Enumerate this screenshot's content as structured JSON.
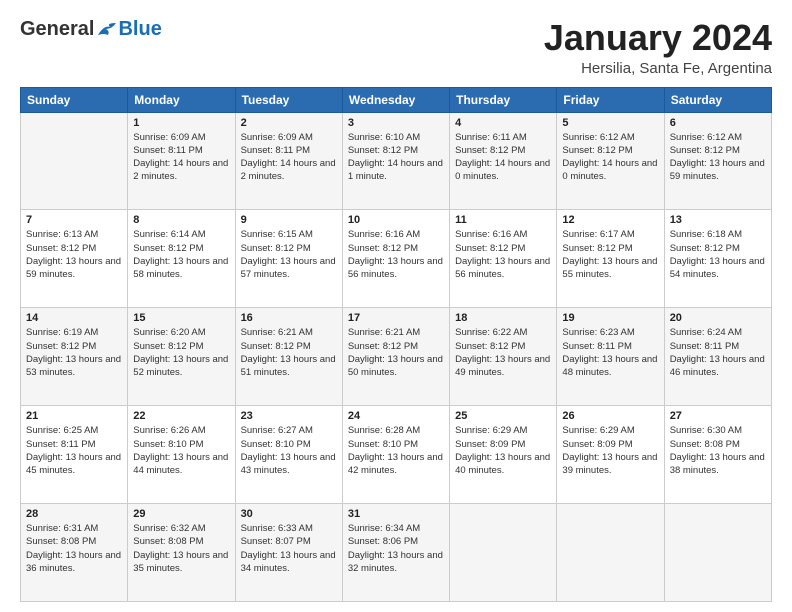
{
  "logo": {
    "general": "General",
    "blue": "Blue"
  },
  "header": {
    "month": "January 2024",
    "location": "Hersilia, Santa Fe, Argentina"
  },
  "weekdays": [
    "Sunday",
    "Monday",
    "Tuesday",
    "Wednesday",
    "Thursday",
    "Friday",
    "Saturday"
  ],
  "weeks": [
    [
      {
        "day": "",
        "sunrise": "",
        "sunset": "",
        "daylight": ""
      },
      {
        "day": "1",
        "sunrise": "Sunrise: 6:09 AM",
        "sunset": "Sunset: 8:11 PM",
        "daylight": "Daylight: 14 hours and 2 minutes."
      },
      {
        "day": "2",
        "sunrise": "Sunrise: 6:09 AM",
        "sunset": "Sunset: 8:11 PM",
        "daylight": "Daylight: 14 hours and 2 minutes."
      },
      {
        "day": "3",
        "sunrise": "Sunrise: 6:10 AM",
        "sunset": "Sunset: 8:12 PM",
        "daylight": "Daylight: 14 hours and 1 minute."
      },
      {
        "day": "4",
        "sunrise": "Sunrise: 6:11 AM",
        "sunset": "Sunset: 8:12 PM",
        "daylight": "Daylight: 14 hours and 0 minutes."
      },
      {
        "day": "5",
        "sunrise": "Sunrise: 6:12 AM",
        "sunset": "Sunset: 8:12 PM",
        "daylight": "Daylight: 14 hours and 0 minutes."
      },
      {
        "day": "6",
        "sunrise": "Sunrise: 6:12 AM",
        "sunset": "Sunset: 8:12 PM",
        "daylight": "Daylight: 13 hours and 59 minutes."
      }
    ],
    [
      {
        "day": "7",
        "sunrise": "Sunrise: 6:13 AM",
        "sunset": "Sunset: 8:12 PM",
        "daylight": "Daylight: 13 hours and 59 minutes."
      },
      {
        "day": "8",
        "sunrise": "Sunrise: 6:14 AM",
        "sunset": "Sunset: 8:12 PM",
        "daylight": "Daylight: 13 hours and 58 minutes."
      },
      {
        "day": "9",
        "sunrise": "Sunrise: 6:15 AM",
        "sunset": "Sunset: 8:12 PM",
        "daylight": "Daylight: 13 hours and 57 minutes."
      },
      {
        "day": "10",
        "sunrise": "Sunrise: 6:16 AM",
        "sunset": "Sunset: 8:12 PM",
        "daylight": "Daylight: 13 hours and 56 minutes."
      },
      {
        "day": "11",
        "sunrise": "Sunrise: 6:16 AM",
        "sunset": "Sunset: 8:12 PM",
        "daylight": "Daylight: 13 hours and 56 minutes."
      },
      {
        "day": "12",
        "sunrise": "Sunrise: 6:17 AM",
        "sunset": "Sunset: 8:12 PM",
        "daylight": "Daylight: 13 hours and 55 minutes."
      },
      {
        "day": "13",
        "sunrise": "Sunrise: 6:18 AM",
        "sunset": "Sunset: 8:12 PM",
        "daylight": "Daylight: 13 hours and 54 minutes."
      }
    ],
    [
      {
        "day": "14",
        "sunrise": "Sunrise: 6:19 AM",
        "sunset": "Sunset: 8:12 PM",
        "daylight": "Daylight: 13 hours and 53 minutes."
      },
      {
        "day": "15",
        "sunrise": "Sunrise: 6:20 AM",
        "sunset": "Sunset: 8:12 PM",
        "daylight": "Daylight: 13 hours and 52 minutes."
      },
      {
        "day": "16",
        "sunrise": "Sunrise: 6:21 AM",
        "sunset": "Sunset: 8:12 PM",
        "daylight": "Daylight: 13 hours and 51 minutes."
      },
      {
        "day": "17",
        "sunrise": "Sunrise: 6:21 AM",
        "sunset": "Sunset: 8:12 PM",
        "daylight": "Daylight: 13 hours and 50 minutes."
      },
      {
        "day": "18",
        "sunrise": "Sunrise: 6:22 AM",
        "sunset": "Sunset: 8:12 PM",
        "daylight": "Daylight: 13 hours and 49 minutes."
      },
      {
        "day": "19",
        "sunrise": "Sunrise: 6:23 AM",
        "sunset": "Sunset: 8:11 PM",
        "daylight": "Daylight: 13 hours and 48 minutes."
      },
      {
        "day": "20",
        "sunrise": "Sunrise: 6:24 AM",
        "sunset": "Sunset: 8:11 PM",
        "daylight": "Daylight: 13 hours and 46 minutes."
      }
    ],
    [
      {
        "day": "21",
        "sunrise": "Sunrise: 6:25 AM",
        "sunset": "Sunset: 8:11 PM",
        "daylight": "Daylight: 13 hours and 45 minutes."
      },
      {
        "day": "22",
        "sunrise": "Sunrise: 6:26 AM",
        "sunset": "Sunset: 8:10 PM",
        "daylight": "Daylight: 13 hours and 44 minutes."
      },
      {
        "day": "23",
        "sunrise": "Sunrise: 6:27 AM",
        "sunset": "Sunset: 8:10 PM",
        "daylight": "Daylight: 13 hours and 43 minutes."
      },
      {
        "day": "24",
        "sunrise": "Sunrise: 6:28 AM",
        "sunset": "Sunset: 8:10 PM",
        "daylight": "Daylight: 13 hours and 42 minutes."
      },
      {
        "day": "25",
        "sunrise": "Sunrise: 6:29 AM",
        "sunset": "Sunset: 8:09 PM",
        "daylight": "Daylight: 13 hours and 40 minutes."
      },
      {
        "day": "26",
        "sunrise": "Sunrise: 6:29 AM",
        "sunset": "Sunset: 8:09 PM",
        "daylight": "Daylight: 13 hours and 39 minutes."
      },
      {
        "day": "27",
        "sunrise": "Sunrise: 6:30 AM",
        "sunset": "Sunset: 8:08 PM",
        "daylight": "Daylight: 13 hours and 38 minutes."
      }
    ],
    [
      {
        "day": "28",
        "sunrise": "Sunrise: 6:31 AM",
        "sunset": "Sunset: 8:08 PM",
        "daylight": "Daylight: 13 hours and 36 minutes."
      },
      {
        "day": "29",
        "sunrise": "Sunrise: 6:32 AM",
        "sunset": "Sunset: 8:08 PM",
        "daylight": "Daylight: 13 hours and 35 minutes."
      },
      {
        "day": "30",
        "sunrise": "Sunrise: 6:33 AM",
        "sunset": "Sunset: 8:07 PM",
        "daylight": "Daylight: 13 hours and 34 minutes."
      },
      {
        "day": "31",
        "sunrise": "Sunrise: 6:34 AM",
        "sunset": "Sunset: 8:06 PM",
        "daylight": "Daylight: 13 hours and 32 minutes."
      },
      {
        "day": "",
        "sunrise": "",
        "sunset": "",
        "daylight": ""
      },
      {
        "day": "",
        "sunrise": "",
        "sunset": "",
        "daylight": ""
      },
      {
        "day": "",
        "sunrise": "",
        "sunset": "",
        "daylight": ""
      }
    ]
  ]
}
